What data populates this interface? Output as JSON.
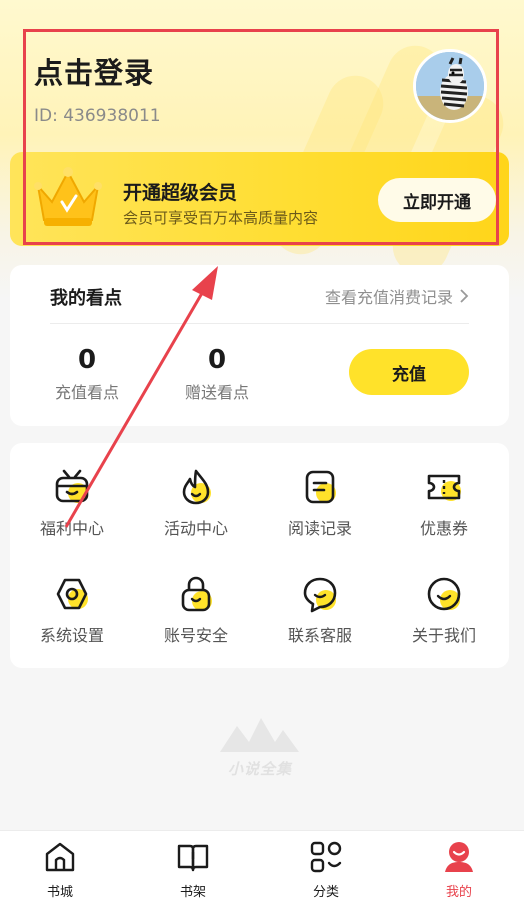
{
  "profile": {
    "login_text": "点击登录",
    "user_id": "ID: 436938011",
    "avatar_alt": "zebra-avatar"
  },
  "vip": {
    "title": "开通超级会员",
    "subtitle": "会员可享受百万本高质量内容",
    "button_label": "立即开通",
    "icon": "crown-icon"
  },
  "points": {
    "title": "我的看点",
    "records_link": "查看充值消费记录",
    "stats": [
      {
        "value": "0",
        "label": "充值看点"
      },
      {
        "value": "0",
        "label": "赠送看点"
      }
    ],
    "recharge_button": "充值"
  },
  "menu": {
    "items": [
      {
        "label": "福利中心",
        "icon": "tv-icon"
      },
      {
        "label": "活动中心",
        "icon": "flame-icon"
      },
      {
        "label": "阅读记录",
        "icon": "document-icon"
      },
      {
        "label": "优惠券",
        "icon": "ticket-icon"
      },
      {
        "label": "系统设置",
        "icon": "settings-icon"
      },
      {
        "label": "账号安全",
        "icon": "lock-icon"
      },
      {
        "label": "联系客服",
        "icon": "chat-icon"
      },
      {
        "label": "关于我们",
        "icon": "smile-icon"
      }
    ]
  },
  "watermark": {
    "text": "小说全集"
  },
  "tabbar": {
    "tabs": [
      {
        "label": "书城",
        "icon": "home-icon",
        "active": false
      },
      {
        "label": "书架",
        "icon": "book-icon",
        "active": false
      },
      {
        "label": "分类",
        "icon": "category-icon",
        "active": false
      },
      {
        "label": "我的",
        "icon": "profile-icon",
        "active": true
      }
    ]
  },
  "colors": {
    "accent_yellow": "#ffe22a",
    "highlight_red": "#e8424c",
    "active_tab": "#e8424c"
  }
}
